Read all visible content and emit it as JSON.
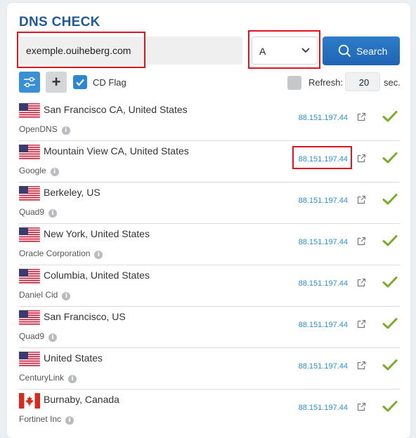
{
  "title": "DNS CHECK",
  "search": {
    "value": "exemple.ouiheberg.com",
    "record_type": "A",
    "button_label": "Search"
  },
  "options": {
    "cd_flag_label": "CD Flag",
    "cd_flag_checked": true,
    "refresh_label": "Refresh:",
    "refresh_value": "20",
    "refresh_unit": "sec."
  },
  "icons": {
    "filter": "sliders-icon",
    "add": "plus-icon",
    "search": "search-icon",
    "dropdown": "chevron-down-icon",
    "external": "external-link-icon",
    "status": "checkmark-icon",
    "info": "info-icon"
  },
  "colors": {
    "accent": "#1f65b4",
    "title": "#1f5b9a",
    "ip": "#2c8fcf",
    "check": "#7aab2c",
    "highlight": "#e0141e"
  },
  "results": [
    {
      "flag": "us",
      "location": "San Francisco CA, United States",
      "provider": "OpenDNS",
      "ip": "88.151.197.44",
      "status": "ok"
    },
    {
      "flag": "us",
      "location": "Mountain View CA, United States",
      "provider": "Google",
      "ip": "88.151.197.44",
      "status": "ok"
    },
    {
      "flag": "us",
      "location": "Berkeley, US",
      "provider": "Quad9",
      "ip": "88.151.197.44",
      "status": "ok"
    },
    {
      "flag": "us",
      "location": "New York, United States",
      "provider": "Oracle Corporation",
      "ip": "88.151.197.44",
      "status": "ok"
    },
    {
      "flag": "us",
      "location": "Columbia, United States",
      "provider": "Daniel Cid",
      "ip": "88.151.197.44",
      "status": "ok"
    },
    {
      "flag": "us",
      "location": "San Francisco, US",
      "provider": "Quad9",
      "ip": "88.151.197.44",
      "status": "ok"
    },
    {
      "flag": "us",
      "location": "United States",
      "provider": "CenturyLink",
      "ip": "88.151.197.44",
      "status": "ok"
    },
    {
      "flag": "ca",
      "location": "Burnaby, Canada",
      "provider": "Fortinet Inc",
      "ip": "88.151.197.44",
      "status": "ok"
    }
  ]
}
